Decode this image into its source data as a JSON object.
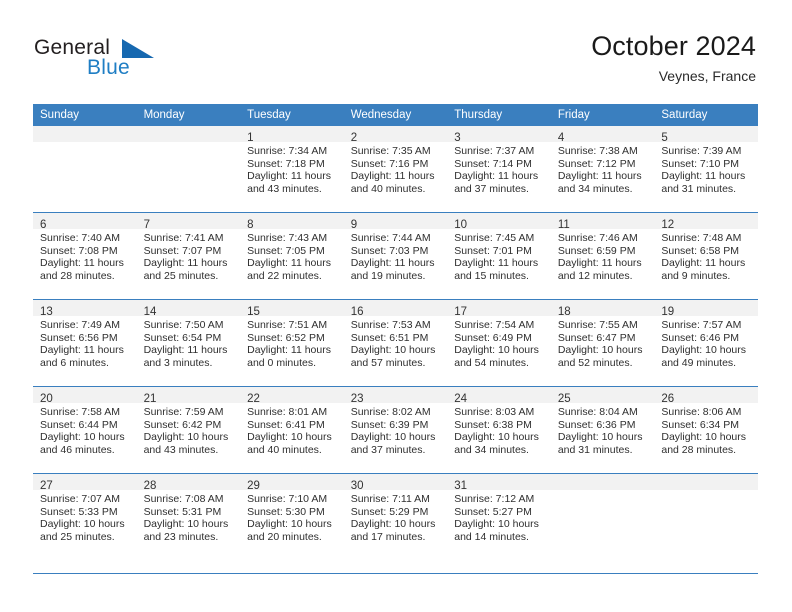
{
  "brand": {
    "name_top": "General",
    "name_bottom": "Blue",
    "triangle_icon": "triangle-icon",
    "accent_color": "#1668b0"
  },
  "header": {
    "month_title": "October 2024",
    "location": "Veynes, France"
  },
  "calendar": {
    "header_color": "#3a7fbf",
    "weekday_headers": [
      "Sunday",
      "Monday",
      "Tuesday",
      "Wednesday",
      "Thursday",
      "Friday",
      "Saturday"
    ],
    "weeks": [
      [
        {
          "day": "",
          "sunrise": "",
          "sunset": "",
          "daylight_line1": "",
          "daylight_line2": ""
        },
        {
          "day": "",
          "sunrise": "",
          "sunset": "",
          "daylight_line1": "",
          "daylight_line2": ""
        },
        {
          "day": "1",
          "sunrise": "Sunrise: 7:34 AM",
          "sunset": "Sunset: 7:18 PM",
          "daylight_line1": "Daylight: 11 hours",
          "daylight_line2": "and 43 minutes."
        },
        {
          "day": "2",
          "sunrise": "Sunrise: 7:35 AM",
          "sunset": "Sunset: 7:16 PM",
          "daylight_line1": "Daylight: 11 hours",
          "daylight_line2": "and 40 minutes."
        },
        {
          "day": "3",
          "sunrise": "Sunrise: 7:37 AM",
          "sunset": "Sunset: 7:14 PM",
          "daylight_line1": "Daylight: 11 hours",
          "daylight_line2": "and 37 minutes."
        },
        {
          "day": "4",
          "sunrise": "Sunrise: 7:38 AM",
          "sunset": "Sunset: 7:12 PM",
          "daylight_line1": "Daylight: 11 hours",
          "daylight_line2": "and 34 minutes."
        },
        {
          "day": "5",
          "sunrise": "Sunrise: 7:39 AM",
          "sunset": "Sunset: 7:10 PM",
          "daylight_line1": "Daylight: 11 hours",
          "daylight_line2": "and 31 minutes."
        }
      ],
      [
        {
          "day": "6",
          "sunrise": "Sunrise: 7:40 AM",
          "sunset": "Sunset: 7:08 PM",
          "daylight_line1": "Daylight: 11 hours",
          "daylight_line2": "and 28 minutes."
        },
        {
          "day": "7",
          "sunrise": "Sunrise: 7:41 AM",
          "sunset": "Sunset: 7:07 PM",
          "daylight_line1": "Daylight: 11 hours",
          "daylight_line2": "and 25 minutes."
        },
        {
          "day": "8",
          "sunrise": "Sunrise: 7:43 AM",
          "sunset": "Sunset: 7:05 PM",
          "daylight_line1": "Daylight: 11 hours",
          "daylight_line2": "and 22 minutes."
        },
        {
          "day": "9",
          "sunrise": "Sunrise: 7:44 AM",
          "sunset": "Sunset: 7:03 PM",
          "daylight_line1": "Daylight: 11 hours",
          "daylight_line2": "and 19 minutes."
        },
        {
          "day": "10",
          "sunrise": "Sunrise: 7:45 AM",
          "sunset": "Sunset: 7:01 PM",
          "daylight_line1": "Daylight: 11 hours",
          "daylight_line2": "and 15 minutes."
        },
        {
          "day": "11",
          "sunrise": "Sunrise: 7:46 AM",
          "sunset": "Sunset: 6:59 PM",
          "daylight_line1": "Daylight: 11 hours",
          "daylight_line2": "and 12 minutes."
        },
        {
          "day": "12",
          "sunrise": "Sunrise: 7:48 AM",
          "sunset": "Sunset: 6:58 PM",
          "daylight_line1": "Daylight: 11 hours",
          "daylight_line2": "and 9 minutes."
        }
      ],
      [
        {
          "day": "13",
          "sunrise": "Sunrise: 7:49 AM",
          "sunset": "Sunset: 6:56 PM",
          "daylight_line1": "Daylight: 11 hours",
          "daylight_line2": "and 6 minutes."
        },
        {
          "day": "14",
          "sunrise": "Sunrise: 7:50 AM",
          "sunset": "Sunset: 6:54 PM",
          "daylight_line1": "Daylight: 11 hours",
          "daylight_line2": "and 3 minutes."
        },
        {
          "day": "15",
          "sunrise": "Sunrise: 7:51 AM",
          "sunset": "Sunset: 6:52 PM",
          "daylight_line1": "Daylight: 11 hours",
          "daylight_line2": "and 0 minutes."
        },
        {
          "day": "16",
          "sunrise": "Sunrise: 7:53 AM",
          "sunset": "Sunset: 6:51 PM",
          "daylight_line1": "Daylight: 10 hours",
          "daylight_line2": "and 57 minutes."
        },
        {
          "day": "17",
          "sunrise": "Sunrise: 7:54 AM",
          "sunset": "Sunset: 6:49 PM",
          "daylight_line1": "Daylight: 10 hours",
          "daylight_line2": "and 54 minutes."
        },
        {
          "day": "18",
          "sunrise": "Sunrise: 7:55 AM",
          "sunset": "Sunset: 6:47 PM",
          "daylight_line1": "Daylight: 10 hours",
          "daylight_line2": "and 52 minutes."
        },
        {
          "day": "19",
          "sunrise": "Sunrise: 7:57 AM",
          "sunset": "Sunset: 6:46 PM",
          "daylight_line1": "Daylight: 10 hours",
          "daylight_line2": "and 49 minutes."
        }
      ],
      [
        {
          "day": "20",
          "sunrise": "Sunrise: 7:58 AM",
          "sunset": "Sunset: 6:44 PM",
          "daylight_line1": "Daylight: 10 hours",
          "daylight_line2": "and 46 minutes."
        },
        {
          "day": "21",
          "sunrise": "Sunrise: 7:59 AM",
          "sunset": "Sunset: 6:42 PM",
          "daylight_line1": "Daylight: 10 hours",
          "daylight_line2": "and 43 minutes."
        },
        {
          "day": "22",
          "sunrise": "Sunrise: 8:01 AM",
          "sunset": "Sunset: 6:41 PM",
          "daylight_line1": "Daylight: 10 hours",
          "daylight_line2": "and 40 minutes."
        },
        {
          "day": "23",
          "sunrise": "Sunrise: 8:02 AM",
          "sunset": "Sunset: 6:39 PM",
          "daylight_line1": "Daylight: 10 hours",
          "daylight_line2": "and 37 minutes."
        },
        {
          "day": "24",
          "sunrise": "Sunrise: 8:03 AM",
          "sunset": "Sunset: 6:38 PM",
          "daylight_line1": "Daylight: 10 hours",
          "daylight_line2": "and 34 minutes."
        },
        {
          "day": "25",
          "sunrise": "Sunrise: 8:04 AM",
          "sunset": "Sunset: 6:36 PM",
          "daylight_line1": "Daylight: 10 hours",
          "daylight_line2": "and 31 minutes."
        },
        {
          "day": "26",
          "sunrise": "Sunrise: 8:06 AM",
          "sunset": "Sunset: 6:34 PM",
          "daylight_line1": "Daylight: 10 hours",
          "daylight_line2": "and 28 minutes."
        }
      ],
      [
        {
          "day": "27",
          "sunrise": "Sunrise: 7:07 AM",
          "sunset": "Sunset: 5:33 PM",
          "daylight_line1": "Daylight: 10 hours",
          "daylight_line2": "and 25 minutes."
        },
        {
          "day": "28",
          "sunrise": "Sunrise: 7:08 AM",
          "sunset": "Sunset: 5:31 PM",
          "daylight_line1": "Daylight: 10 hours",
          "daylight_line2": "and 23 minutes."
        },
        {
          "day": "29",
          "sunrise": "Sunrise: 7:10 AM",
          "sunset": "Sunset: 5:30 PM",
          "daylight_line1": "Daylight: 10 hours",
          "daylight_line2": "and 20 minutes."
        },
        {
          "day": "30",
          "sunrise": "Sunrise: 7:11 AM",
          "sunset": "Sunset: 5:29 PM",
          "daylight_line1": "Daylight: 10 hours",
          "daylight_line2": "and 17 minutes."
        },
        {
          "day": "31",
          "sunrise": "Sunrise: 7:12 AM",
          "sunset": "Sunset: 5:27 PM",
          "daylight_line1": "Daylight: 10 hours",
          "daylight_line2": "and 14 minutes."
        },
        {
          "day": "",
          "sunrise": "",
          "sunset": "",
          "daylight_line1": "",
          "daylight_line2": ""
        },
        {
          "day": "",
          "sunrise": "",
          "sunset": "",
          "daylight_line1": "",
          "daylight_line2": ""
        }
      ]
    ]
  }
}
